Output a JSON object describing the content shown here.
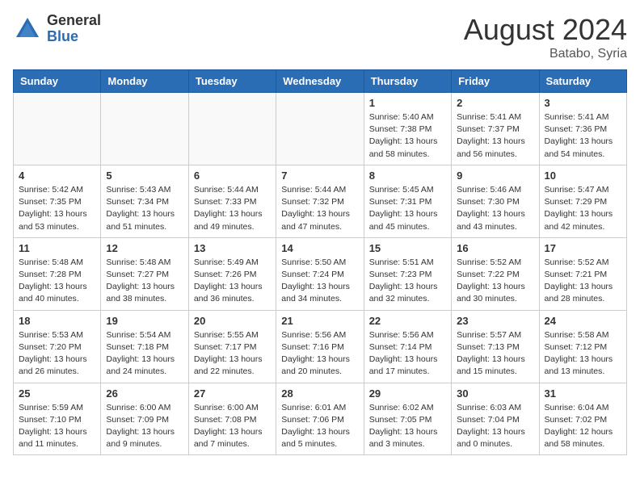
{
  "header": {
    "logo_general": "General",
    "logo_blue": "Blue",
    "month_year": "August 2024",
    "location": "Batabo, Syria"
  },
  "weekdays": [
    "Sunday",
    "Monday",
    "Tuesday",
    "Wednesday",
    "Thursday",
    "Friday",
    "Saturday"
  ],
  "weeks": [
    [
      {
        "day": "",
        "text": ""
      },
      {
        "day": "",
        "text": ""
      },
      {
        "day": "",
        "text": ""
      },
      {
        "day": "",
        "text": ""
      },
      {
        "day": "1",
        "text": "Sunrise: 5:40 AM\nSunset: 7:38 PM\nDaylight: 13 hours\nand 58 minutes."
      },
      {
        "day": "2",
        "text": "Sunrise: 5:41 AM\nSunset: 7:37 PM\nDaylight: 13 hours\nand 56 minutes."
      },
      {
        "day": "3",
        "text": "Sunrise: 5:41 AM\nSunset: 7:36 PM\nDaylight: 13 hours\nand 54 minutes."
      }
    ],
    [
      {
        "day": "4",
        "text": "Sunrise: 5:42 AM\nSunset: 7:35 PM\nDaylight: 13 hours\nand 53 minutes."
      },
      {
        "day": "5",
        "text": "Sunrise: 5:43 AM\nSunset: 7:34 PM\nDaylight: 13 hours\nand 51 minutes."
      },
      {
        "day": "6",
        "text": "Sunrise: 5:44 AM\nSunset: 7:33 PM\nDaylight: 13 hours\nand 49 minutes."
      },
      {
        "day": "7",
        "text": "Sunrise: 5:44 AM\nSunset: 7:32 PM\nDaylight: 13 hours\nand 47 minutes."
      },
      {
        "day": "8",
        "text": "Sunrise: 5:45 AM\nSunset: 7:31 PM\nDaylight: 13 hours\nand 45 minutes."
      },
      {
        "day": "9",
        "text": "Sunrise: 5:46 AM\nSunset: 7:30 PM\nDaylight: 13 hours\nand 43 minutes."
      },
      {
        "day": "10",
        "text": "Sunrise: 5:47 AM\nSunset: 7:29 PM\nDaylight: 13 hours\nand 42 minutes."
      }
    ],
    [
      {
        "day": "11",
        "text": "Sunrise: 5:48 AM\nSunset: 7:28 PM\nDaylight: 13 hours\nand 40 minutes."
      },
      {
        "day": "12",
        "text": "Sunrise: 5:48 AM\nSunset: 7:27 PM\nDaylight: 13 hours\nand 38 minutes."
      },
      {
        "day": "13",
        "text": "Sunrise: 5:49 AM\nSunset: 7:26 PM\nDaylight: 13 hours\nand 36 minutes."
      },
      {
        "day": "14",
        "text": "Sunrise: 5:50 AM\nSunset: 7:24 PM\nDaylight: 13 hours\nand 34 minutes."
      },
      {
        "day": "15",
        "text": "Sunrise: 5:51 AM\nSunset: 7:23 PM\nDaylight: 13 hours\nand 32 minutes."
      },
      {
        "day": "16",
        "text": "Sunrise: 5:52 AM\nSunset: 7:22 PM\nDaylight: 13 hours\nand 30 minutes."
      },
      {
        "day": "17",
        "text": "Sunrise: 5:52 AM\nSunset: 7:21 PM\nDaylight: 13 hours\nand 28 minutes."
      }
    ],
    [
      {
        "day": "18",
        "text": "Sunrise: 5:53 AM\nSunset: 7:20 PM\nDaylight: 13 hours\nand 26 minutes."
      },
      {
        "day": "19",
        "text": "Sunrise: 5:54 AM\nSunset: 7:18 PM\nDaylight: 13 hours\nand 24 minutes."
      },
      {
        "day": "20",
        "text": "Sunrise: 5:55 AM\nSunset: 7:17 PM\nDaylight: 13 hours\nand 22 minutes."
      },
      {
        "day": "21",
        "text": "Sunrise: 5:56 AM\nSunset: 7:16 PM\nDaylight: 13 hours\nand 20 minutes."
      },
      {
        "day": "22",
        "text": "Sunrise: 5:56 AM\nSunset: 7:14 PM\nDaylight: 13 hours\nand 17 minutes."
      },
      {
        "day": "23",
        "text": "Sunrise: 5:57 AM\nSunset: 7:13 PM\nDaylight: 13 hours\nand 15 minutes."
      },
      {
        "day": "24",
        "text": "Sunrise: 5:58 AM\nSunset: 7:12 PM\nDaylight: 13 hours\nand 13 minutes."
      }
    ],
    [
      {
        "day": "25",
        "text": "Sunrise: 5:59 AM\nSunset: 7:10 PM\nDaylight: 13 hours\nand 11 minutes."
      },
      {
        "day": "26",
        "text": "Sunrise: 6:00 AM\nSunset: 7:09 PM\nDaylight: 13 hours\nand 9 minutes."
      },
      {
        "day": "27",
        "text": "Sunrise: 6:00 AM\nSunset: 7:08 PM\nDaylight: 13 hours\nand 7 minutes."
      },
      {
        "day": "28",
        "text": "Sunrise: 6:01 AM\nSunset: 7:06 PM\nDaylight: 13 hours\nand 5 minutes."
      },
      {
        "day": "29",
        "text": "Sunrise: 6:02 AM\nSunset: 7:05 PM\nDaylight: 13 hours\nand 3 minutes."
      },
      {
        "day": "30",
        "text": "Sunrise: 6:03 AM\nSunset: 7:04 PM\nDaylight: 13 hours\nand 0 minutes."
      },
      {
        "day": "31",
        "text": "Sunrise: 6:04 AM\nSunset: 7:02 PM\nDaylight: 12 hours\nand 58 minutes."
      }
    ]
  ]
}
